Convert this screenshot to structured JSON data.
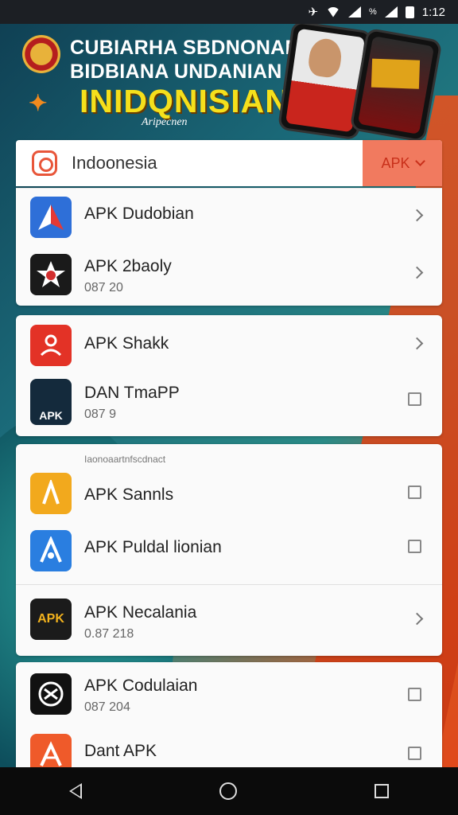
{
  "status": {
    "time": "1:12"
  },
  "banner": {
    "line1": "CUBIARHA SBDNONAN",
    "line2": "BIDBIANA UNDANIAN",
    "headline": "INIDQNISIAN",
    "tagline": "Aripecnen"
  },
  "search": {
    "value": "Indoonesia",
    "filter_label": "APK"
  },
  "cards": [
    {
      "rows": [
        {
          "title": "APK Dudobian",
          "sub": "",
          "action": "chevron",
          "icon": "red-blue-triangle-icon",
          "color": "#2e6fd8"
        },
        {
          "title": "APK 2baoly",
          "sub": "087 20",
          "action": "chevron",
          "icon": "dark-star-icon",
          "color": "#1a1a1a"
        }
      ]
    },
    {
      "rows": [
        {
          "title": "APK Shakk",
          "sub": "",
          "action": "chevron",
          "icon": "red-figure-icon",
          "color": "#e33226"
        },
        {
          "title": "DAN TmaPP",
          "sub": "087 9",
          "action": "checkbox",
          "icon": "apk-wing-icon",
          "color": "#142a3c"
        }
      ]
    },
    {
      "section": "Iaonoaartnfscdnact",
      "rows": [
        {
          "title": "APK Sannls",
          "sub": "",
          "action": "checkbox",
          "icon": "yellow-a-icon",
          "color": "#f2a91d"
        },
        {
          "title": "APK Puldal lionian",
          "sub": "",
          "action": "checkbox",
          "icon": "blue-a-icon",
          "color": "#2a7ee0"
        },
        {
          "title": "APK Necalania",
          "sub": "0.87 218",
          "action": "chevron",
          "icon": "black-gold-apk-icon",
          "color": "#1b1b1b"
        }
      ]
    },
    {
      "rows": [
        {
          "title": "APK Codulaian",
          "sub": "087 204",
          "action": "checkbox",
          "icon": "black-ornament-icon",
          "color": "#111111"
        },
        {
          "title": "Dant APK",
          "sub": "",
          "action": "checkbox",
          "icon": "orange-a-icon",
          "color": "#ef5a2a"
        }
      ]
    }
  ],
  "icons": {
    "apk": "APK",
    "apk_gold": "APK"
  },
  "colors": {
    "accent": "#e8563a",
    "filter_bg": "#f17a5f",
    "headline": "#f5e01c"
  }
}
